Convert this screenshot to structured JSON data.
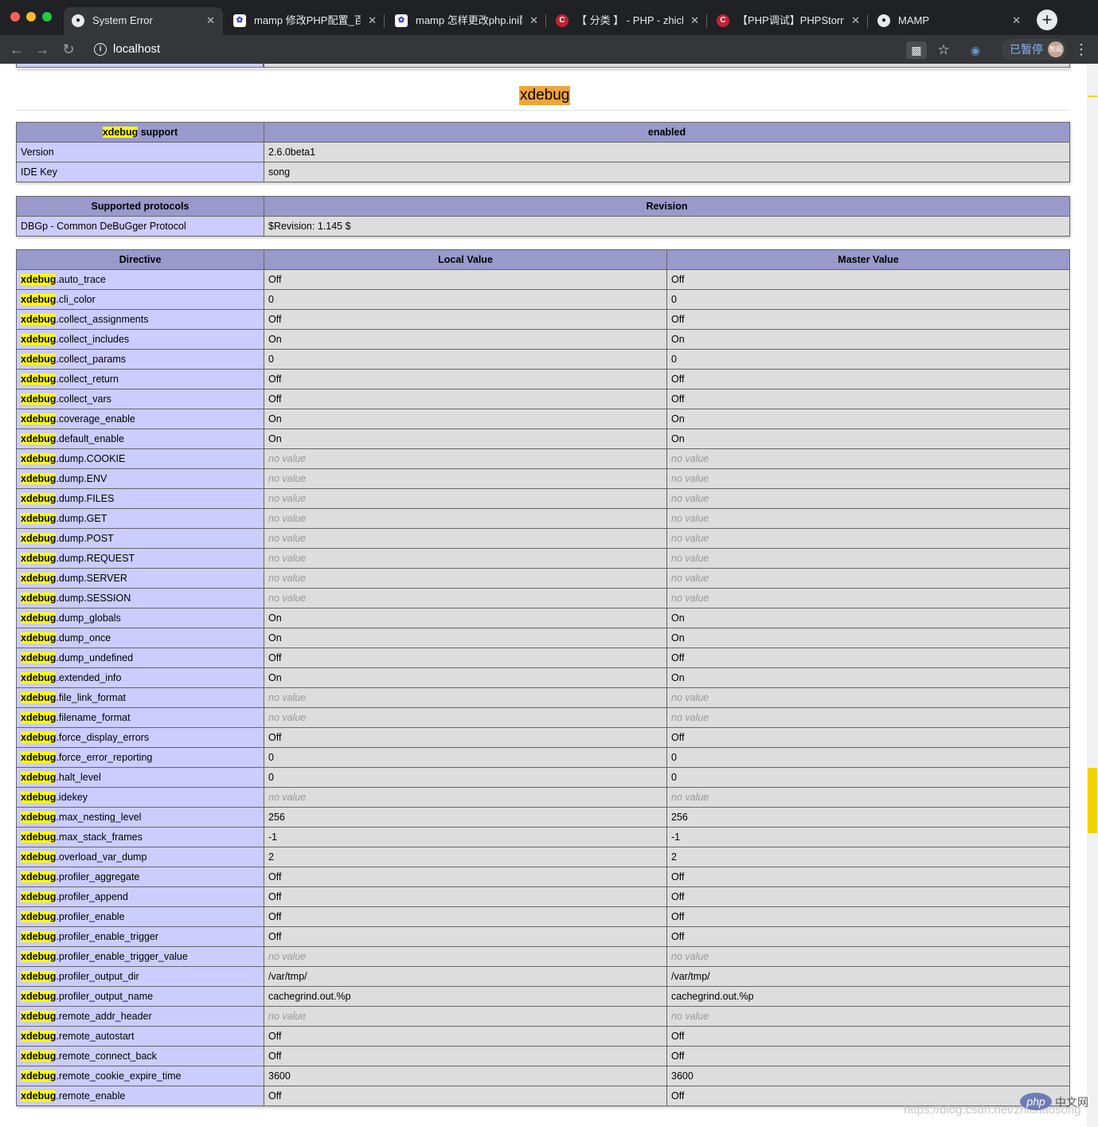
{
  "browser": {
    "tabs": [
      {
        "title": "System Error",
        "favicon": "globe-icon",
        "active": true
      },
      {
        "title": "mamp 修改PHP配置_百度",
        "favicon": "baidu-icon",
        "active": false
      },
      {
        "title": "mamp 怎样更改php.ini配",
        "favicon": "baidu-icon",
        "active": false
      },
      {
        "title": "【 分类 】 - PHP - zhicha",
        "favicon": "csdn-icon",
        "active": false
      },
      {
        "title": "【PHP调试】PHPStorm",
        "favicon": "csdn-icon",
        "active": false
      },
      {
        "title": "MAMP",
        "favicon": "globe-icon",
        "active": false
      }
    ],
    "new_tab": "+",
    "url": "localhost",
    "pause_label": "已暂停",
    "avatar_label": "智超"
  },
  "section_title": "xdebug",
  "support_table": {
    "header_prefix": "xdebug",
    "header_suffix": " support",
    "header_value": "enabled",
    "rows": [
      {
        "name": "Version",
        "value": "2.6.0beta1"
      },
      {
        "name": "IDE Key",
        "value": "song"
      }
    ]
  },
  "protocols_table": {
    "headers": [
      "Supported protocols",
      "Revision"
    ],
    "rows": [
      {
        "name": "DBGp - Common DeBuGger Protocol",
        "value": "$Revision: 1.145 $"
      }
    ]
  },
  "directives": {
    "headers": [
      "Directive",
      "Local Value",
      "Master Value"
    ],
    "prefix": "xdebug",
    "rows": [
      {
        "name": ".auto_trace",
        "local": "Off",
        "master": "Off"
      },
      {
        "name": ".cli_color",
        "local": "0",
        "master": "0"
      },
      {
        "name": ".collect_assignments",
        "local": "Off",
        "master": "Off"
      },
      {
        "name": ".collect_includes",
        "local": "On",
        "master": "On"
      },
      {
        "name": ".collect_params",
        "local": "0",
        "master": "0"
      },
      {
        "name": ".collect_return",
        "local": "Off",
        "master": "Off"
      },
      {
        "name": ".collect_vars",
        "local": "Off",
        "master": "Off"
      },
      {
        "name": ".coverage_enable",
        "local": "On",
        "master": "On"
      },
      {
        "name": ".default_enable",
        "local": "On",
        "master": "On"
      },
      {
        "name": ".dump.COOKIE",
        "local": "no value",
        "master": "no value"
      },
      {
        "name": ".dump.ENV",
        "local": "no value",
        "master": "no value"
      },
      {
        "name": ".dump.FILES",
        "local": "no value",
        "master": "no value"
      },
      {
        "name": ".dump.GET",
        "local": "no value",
        "master": "no value"
      },
      {
        "name": ".dump.POST",
        "local": "no value",
        "master": "no value"
      },
      {
        "name": ".dump.REQUEST",
        "local": "no value",
        "master": "no value"
      },
      {
        "name": ".dump.SERVER",
        "local": "no value",
        "master": "no value"
      },
      {
        "name": ".dump.SESSION",
        "local": "no value",
        "master": "no value"
      },
      {
        "name": ".dump_globals",
        "local": "On",
        "master": "On"
      },
      {
        "name": ".dump_once",
        "local": "On",
        "master": "On"
      },
      {
        "name": ".dump_undefined",
        "local": "Off",
        "master": "Off"
      },
      {
        "name": ".extended_info",
        "local": "On",
        "master": "On"
      },
      {
        "name": ".file_link_format",
        "local": "no value",
        "master": "no value"
      },
      {
        "name": ".filename_format",
        "local": "no value",
        "master": "no value"
      },
      {
        "name": ".force_display_errors",
        "local": "Off",
        "master": "Off"
      },
      {
        "name": ".force_error_reporting",
        "local": "0",
        "master": "0"
      },
      {
        "name": ".halt_level",
        "local": "0",
        "master": "0"
      },
      {
        "name": ".idekey",
        "local": "no value",
        "master": "no value"
      },
      {
        "name": ".max_nesting_level",
        "local": "256",
        "master": "256"
      },
      {
        "name": ".max_stack_frames",
        "local": "-1",
        "master": "-1"
      },
      {
        "name": ".overload_var_dump",
        "local": "2",
        "master": "2"
      },
      {
        "name": ".profiler_aggregate",
        "local": "Off",
        "master": "Off"
      },
      {
        "name": ".profiler_append",
        "local": "Off",
        "master": "Off"
      },
      {
        "name": ".profiler_enable",
        "local": "Off",
        "master": "Off"
      },
      {
        "name": ".profiler_enable_trigger",
        "local": "Off",
        "master": "Off"
      },
      {
        "name": ".profiler_enable_trigger_value",
        "local": "no value",
        "master": "no value"
      },
      {
        "name": ".profiler_output_dir",
        "local": "/var/tmp/",
        "master": "/var/tmp/"
      },
      {
        "name": ".profiler_output_name",
        "local": "cachegrind.out.%p",
        "master": "cachegrind.out.%p"
      },
      {
        "name": ".remote_addr_header",
        "local": "no value",
        "master": "no value"
      },
      {
        "name": ".remote_autostart",
        "local": "Off",
        "master": "Off"
      },
      {
        "name": ".remote_connect_back",
        "local": "Off",
        "master": "Off"
      },
      {
        "name": ".remote_cookie_expire_time",
        "local": "3600",
        "master": "3600"
      },
      {
        "name": ".remote_enable",
        "local": "Off",
        "master": "Off"
      }
    ]
  },
  "watermark": {
    "url": "https://blog.csdn.net/zhichaosong",
    "logo": "php",
    "site": "中文网"
  }
}
